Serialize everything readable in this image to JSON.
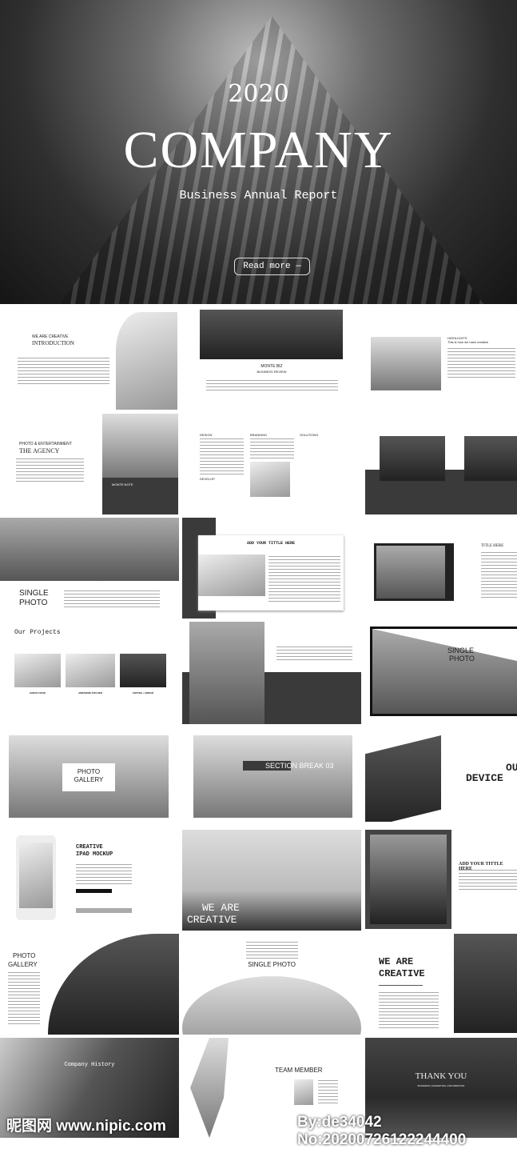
{
  "hero": {
    "year": "2020",
    "title": "COMPANY",
    "subtitle": "Business Annual Report",
    "button": "Read more  —"
  },
  "slides": {
    "intro": {
      "kicker": "WE ARE CREATIVE",
      "title": "INTRODUCTION"
    },
    "monte": {
      "title": "MONTE BIZ",
      "subtitle": "BUSINESS REVIEW"
    },
    "highlights": {
      "title": "HIGHLIGHTS",
      "subtitle": "This is how we have creative"
    },
    "agency": {
      "kicker": "PHOTO & ENTERTAINMENT",
      "title": "THE AGENCY",
      "caption": "MONTE NOTE"
    },
    "columns": {
      "items": [
        "DESIGN",
        "BRANDING",
        "SOLUTIONS",
        "DEVELOP"
      ]
    },
    "single1": {
      "title1": "SINGLE",
      "title2": "PHOTO"
    },
    "addtitle": {
      "title": "ADD YOUR TITTLE HERE"
    },
    "titlehere": {
      "title": "TITLE HERE"
    },
    "projects": {
      "title": "Our Projects",
      "items": [
        "GREAT FOOD",
        "AWESOME KITCHEN",
        "COFFEE + BREAD"
      ]
    },
    "single2": {
      "title1": "SINGLE",
      "title2": "PHOTO"
    },
    "gallery": {
      "title1": "PHOTO",
      "title2": "GALLERY"
    },
    "section": {
      "title": "SECTION BREAK 03"
    },
    "devices": {
      "title1": "OU",
      "title2": "DEVICE"
    },
    "ipad": {
      "title1": "CREATIVE",
      "title2": "IPAD MOCKUP"
    },
    "creative1": {
      "title1": "WE ARE",
      "title2": "CREATIVE"
    },
    "addtitle2": {
      "title": "ADD YOUR TITTLE HERE"
    },
    "gallery2": {
      "title1": "PHOTO",
      "title2": "GALLERY"
    },
    "single3": {
      "title": "SINGLE PHOTO"
    },
    "creative2": {
      "title1": "WE ARE",
      "title2": "CREATIVE"
    },
    "history": {
      "title": "Company History"
    },
    "team": {
      "title": "TEAM MEMBER"
    },
    "thanks": {
      "title": "THANK YOU",
      "subtitle": "BUSINESS | MARKETING | INFORMATION"
    }
  },
  "watermark": {
    "left": "昵图网 www.nipic.com",
    "right": "By:de34042 No:20200726122244400"
  }
}
